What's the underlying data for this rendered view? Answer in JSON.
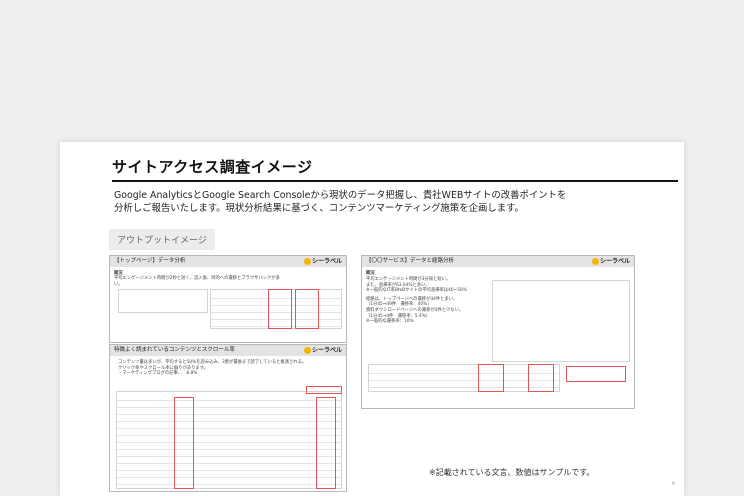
{
  "slide": {
    "title": "サイトアクセス調査イメージ",
    "description_line1": "Google AnalyticsとGoogle Search Consoleから現状のデータ把握し、貴社WEBサイトの改善ポイントを",
    "description_line2": "分析しご報告いたします。現状分析結果に基づく、コンテンツマーケティング施策を企画します。",
    "output_tag": "アウトプットイメージ",
    "footer_note": "※記載されている文言、数値はサンプルです。",
    "page_number": "9"
  },
  "report_pages": [
    {
      "title": "【トップページ】データ分析",
      "body_heading": "概況",
      "body_line1": "平均エンゲージメント時間が2秒と短く、流入後、目的への遷移とブラウザバックが多い。"
    },
    {
      "title": "【〇〇サービス】データと経路分析",
      "body_heading": "概況",
      "body_line1": "平均エンゲージメント時間が3分弱と短い。",
      "body_line2": "また、直帰率が63.64%と多い。",
      "body_line3": "※一般的なIT系BtoBサイトの平均直帰率は40~50%",
      "body_line4": "経路は、トップページへの遷移が44件と多い。",
      "body_line5": "（1分45→49件　遷移率：40%）",
      "body_line6": "資料ダウンロードページへの遷移が4件と少ない。",
      "body_line7": "（1分45→4件　遷移率：5.4%）",
      "body_line8": "※一般的な遷移率：10%"
    },
    {
      "title": "特徴よく読まれているコンテンツとスクロール率",
      "body_line1": "コンテンツ量は多いが、平均すると50%を読み込み、3割が最後まで読了していると推測される。",
      "body_line2": "クリック率やスクロール率に偏りがあります。",
      "body_line3": "・マーケティングブログの記事…　8.8%"
    }
  ],
  "brand": {
    "name": "シーラベル",
    "accent": "#f2b705"
  },
  "colors": {
    "highlight": "#e05555",
    "rule": "#111111"
  }
}
